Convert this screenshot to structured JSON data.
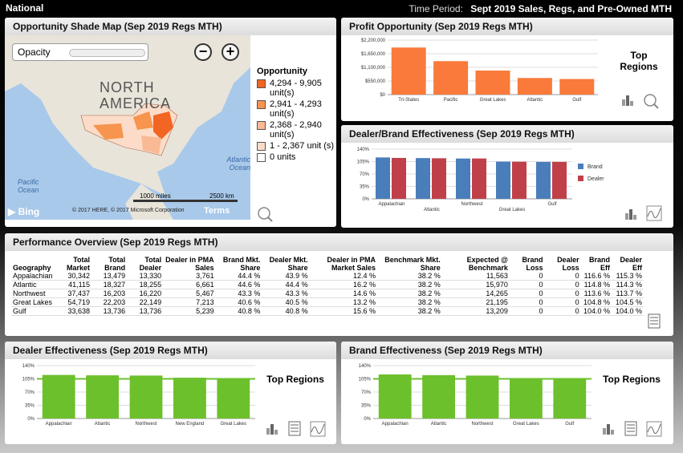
{
  "header": {
    "scope": "National",
    "time_label": "Time Period:",
    "time_value": "Sept 2019 Sales, Regs, and Pre-Owned MTH"
  },
  "map_panel": {
    "title": "Opportunity Shade Map (Sep 2019 Regs MTH)",
    "opacity_label": "Opacity",
    "zoom_out": "−",
    "zoom_in": "+",
    "labels": {
      "continent": "NORTH AMERICA",
      "ocean_pacific": "Pacific Ocean",
      "ocean_atlantic": "Atlantic Ocean"
    },
    "scale_miles": "1000 miles",
    "scale_km": "2500 km",
    "bing": "Bing",
    "copyright": "© 2017 HERE, © 2017 Microsoft Corporation",
    "terms": "Terms",
    "legend": {
      "title": "Opportunity",
      "items": [
        {
          "label": "4,294 - 9,905 unit(s)",
          "color": "#f26522"
        },
        {
          "label": "2,941 - 4,293 unit(s)",
          "color": "#f7944d"
        },
        {
          "label": "2,368 - 2,940 unit(s)",
          "color": "#f9b995"
        },
        {
          "label": "1 - 2,367 unit (s)",
          "color": "#fcdcc8"
        },
        {
          "label": "0 units",
          "color": "#ffffff"
        }
      ]
    }
  },
  "profit_panel": {
    "title": "Profit Opportunity (Sep 2019 Regs MTH)",
    "top_regions": "Top Regions",
    "chart_data": {
      "type": "bar",
      "categories": [
        "Tri-States",
        "Pacific",
        "Great Lakes",
        "Atlantic",
        "Gulf"
      ],
      "values": [
        1900000,
        1350000,
        970000,
        670000,
        630000
      ],
      "ylim": [
        0,
        2200000
      ],
      "yticks": [
        "$0",
        "$550,000",
        "$1,100,000",
        "$1,650,000",
        "$2,200,000"
      ],
      "color": "#f97a3a"
    }
  },
  "effect_panel": {
    "title": "Dealer/Brand Effectiveness (Sep 2019 Regs MTH)",
    "chart_data": {
      "type": "bar",
      "categories": [
        "Appalachian",
        "Atlantic",
        "Northwest",
        "Great Lakes",
        "Gulf"
      ],
      "series": [
        {
          "name": "Brand",
          "values": [
            116.6,
            114.8,
            113.6,
            104.8,
            104.0
          ],
          "color": "#4a7ebb"
        },
        {
          "name": "Dealer",
          "values": [
            115.3,
            114.3,
            113.7,
            104.5,
            104.0
          ],
          "color": "#c0404a"
        }
      ],
      "ylim": [
        0,
        140
      ],
      "yticks": [
        "0%",
        "35%",
        "70%",
        "105%",
        "140%"
      ]
    }
  },
  "perf_panel": {
    "title": "Performance Overview (Sep 2019 Regs MTH)",
    "columns": [
      "Geography",
      "Total Market",
      "Total Brand",
      "Total Dealer",
      "Dealer in PMA Sales",
      "Brand Mkt. Share",
      "Dealer Mkt. Share",
      "Dealer in PMA Market Sales",
      "Benchmark Mkt. Share",
      "Expected @ Benchmark",
      "Brand Loss",
      "Dealer Loss",
      "Brand Eff",
      "Dealer Eff"
    ],
    "rows": [
      [
        "Appalachian",
        "30,342",
        "13,479",
        "13,330",
        "3,761",
        "44.4 %",
        "43.9 %",
        "12.4 %",
        "38.2 %",
        "11,563",
        "0",
        "0",
        "116.6 %",
        "115.3 %"
      ],
      [
        "Atlantic",
        "41,115",
        "18,327",
        "18,255",
        "6,661",
        "44.6 %",
        "44.4 %",
        "16.2 %",
        "38.2 %",
        "15,970",
        "0",
        "0",
        "114.8 %",
        "114.3 %"
      ],
      [
        "Northwest",
        "37,437",
        "16,203",
        "16,220",
        "5,467",
        "43.3 %",
        "43.3 %",
        "14.6 %",
        "38.2 %",
        "14,265",
        "0",
        "0",
        "113.6 %",
        "113.7 %"
      ],
      [
        "Great Lakes",
        "54,719",
        "22,203",
        "22,149",
        "7,213",
        "40.6 %",
        "40.5 %",
        "13.2 %",
        "38.2 %",
        "21,195",
        "0",
        "0",
        "104.8 %",
        "104.5 %"
      ],
      [
        "Gulf",
        "33,638",
        "13,736",
        "13,736",
        "5,239",
        "40.8 %",
        "40.8 %",
        "15.6 %",
        "38.2 %",
        "13,209",
        "0",
        "0",
        "104.0 %",
        "104.0 %"
      ]
    ]
  },
  "dealer_panel": {
    "title": "Dealer Effectiveness (Sep 2019 Regs MTH)",
    "top_regions": "Top Regions",
    "chart_data": {
      "type": "bar",
      "categories": [
        "Appalachian",
        "Atlantic",
        "Northwest",
        "New England",
        "Great Lakes"
      ],
      "values": [
        115.3,
        114.3,
        113.7,
        108.0,
        104.5
      ],
      "ylim": [
        0,
        140
      ],
      "reference": 105,
      "yticks": [
        "0%",
        "35%",
        "70%",
        "105%",
        "140%"
      ],
      "color": "#6cc02c"
    }
  },
  "brand_panel": {
    "title": "Brand Effectiveness (Sep 2019 Regs MTH)",
    "top_regions": "Top Regions",
    "chart_data": {
      "type": "bar",
      "categories": [
        "Appalachian",
        "Atlantic",
        "Northwest",
        "Great Lakes",
        "Gulf"
      ],
      "values": [
        116.6,
        114.8,
        113.6,
        104.8,
        104.0
      ],
      "ylim": [
        0,
        140
      ],
      "reference": 105,
      "yticks": [
        "0%",
        "35%",
        "70%",
        "105%",
        "140%"
      ],
      "color": "#6cc02c"
    }
  }
}
